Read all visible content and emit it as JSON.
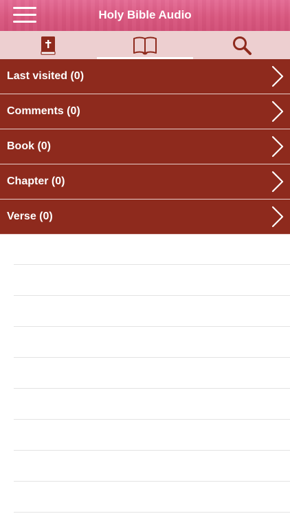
{
  "header": {
    "title": "Holy Bible Audio"
  },
  "tabs": [
    {
      "id": "bible",
      "icon": "bible-book-icon",
      "active": false
    },
    {
      "id": "reading",
      "icon": "open-book-icon",
      "active": true
    },
    {
      "id": "search",
      "icon": "search-icon",
      "active": false
    }
  ],
  "list": {
    "items": [
      {
        "label": "Last visited (0)"
      },
      {
        "label": "Comments (0)"
      },
      {
        "label": "Book (0)"
      },
      {
        "label": "Chapter (0)"
      },
      {
        "label": "Verse (0)"
      }
    ]
  },
  "colors": {
    "header": "#d9577f",
    "tabbar": "#edcfd0",
    "row": "#8e2a1d",
    "icon": "#8e2a1d"
  }
}
